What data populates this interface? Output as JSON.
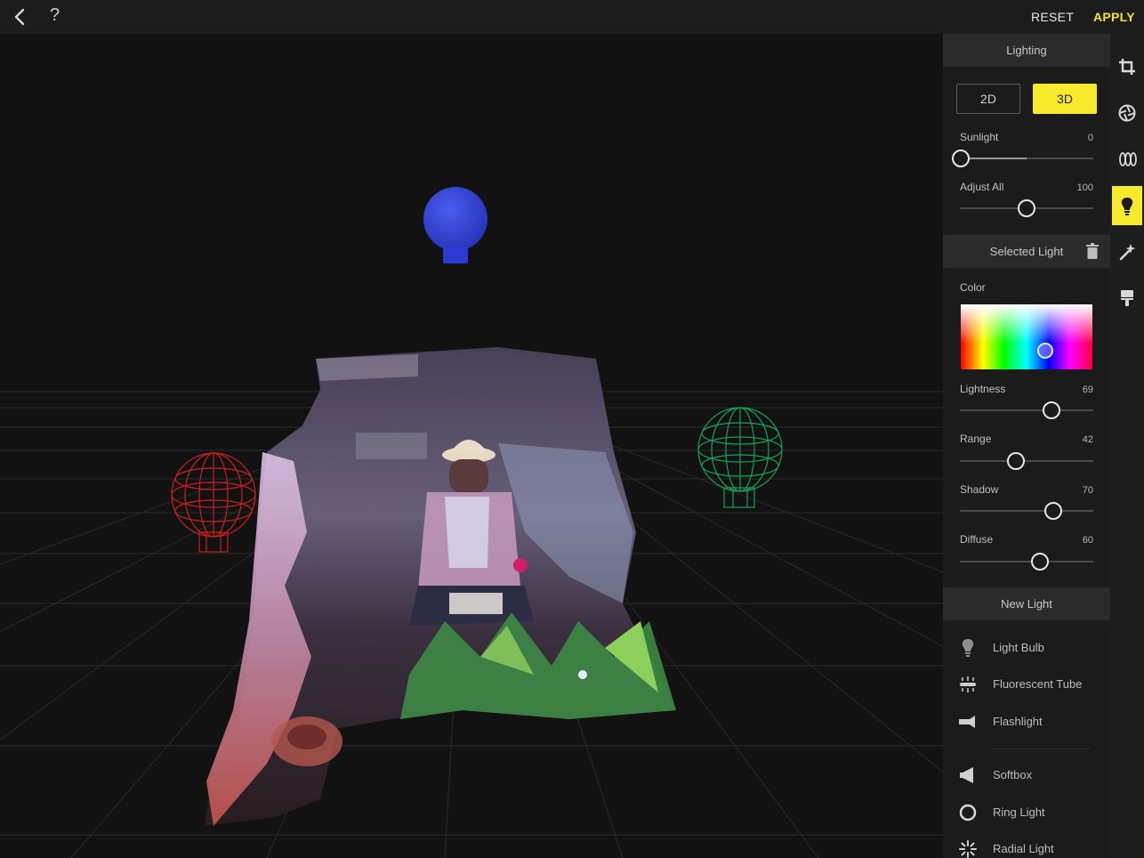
{
  "topbar": {
    "back_icon": "chevron-left-icon",
    "help_label": "?",
    "reset_label": "RESET",
    "apply_label": "APPLY",
    "apply_color": "#f5e52a"
  },
  "viewport": {
    "lights": [
      {
        "kind": "solid",
        "color": "#3d4bdc"
      },
      {
        "kind": "wireframe",
        "color": "#c8201e"
      },
      {
        "kind": "wireframe",
        "color": "#16a05a"
      }
    ]
  },
  "panel": {
    "lighting_title": "Lighting",
    "mode_2d_label": "2D",
    "mode_3d_label": "3D",
    "mode_selected": "3D",
    "accent_color": "#f7ea2d",
    "sliders_top": [
      {
        "label": "Sunlight",
        "value": "0",
        "fraction": 0.0
      },
      {
        "label": "Adjust All",
        "value": "100",
        "fraction": 0.5
      }
    ],
    "selected_light_title": "Selected Light",
    "color_label": "Color",
    "sliders_selected": [
      {
        "label": "Lightness",
        "value": "69",
        "fraction": 0.69
      },
      {
        "label": "Range",
        "value": "42",
        "fraction": 0.42
      },
      {
        "label": "Shadow",
        "value": "70",
        "fraction": 0.7
      },
      {
        "label": "Diffuse",
        "value": "60",
        "fraction": 0.6
      }
    ],
    "new_light_title": "New Light",
    "new_lights": [
      {
        "label": "Light Bulb",
        "icon": "light-bulb-icon"
      },
      {
        "label": "Fluorescent Tube",
        "icon": "fluorescent-tube-icon"
      },
      {
        "label": "Flashlight",
        "icon": "flashlight-icon"
      },
      {
        "label": "Softbox",
        "icon": "softbox-icon"
      },
      {
        "label": "Ring Light",
        "icon": "ring-light-icon"
      },
      {
        "label": "Radial Light",
        "icon": "radial-light-icon"
      }
    ]
  },
  "toolbar": {
    "tools": [
      {
        "icon": "crop-icon"
      },
      {
        "icon": "aperture-icon"
      },
      {
        "icon": "lens-icon"
      },
      {
        "icon": "light-bulb-icon",
        "active": true
      },
      {
        "icon": "magic-wand-icon"
      },
      {
        "icon": "paint-brush-icon"
      }
    ]
  }
}
